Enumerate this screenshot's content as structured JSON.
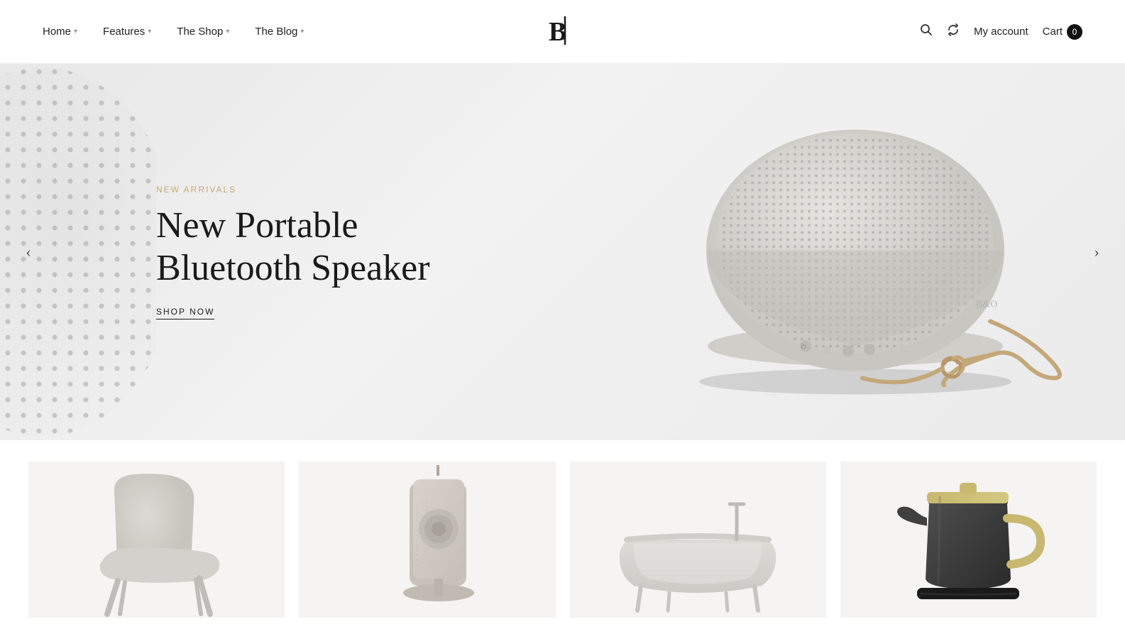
{
  "header": {
    "nav": [
      {
        "label": "Home",
        "has_dropdown": true
      },
      {
        "label": "Features",
        "has_dropdown": true
      },
      {
        "label": "The Shop",
        "has_dropdown": true
      },
      {
        "label": "The Blog",
        "has_dropdown": true
      }
    ],
    "logo_alt": "B Logo",
    "my_account_label": "My account",
    "cart_label": "Cart",
    "cart_count": "0"
  },
  "hero": {
    "tag": "NEW ARRIVALS",
    "title_line1": "New Portable",
    "title_line2": "Bluetooth Speaker",
    "shop_now_label": "SHOP NOW",
    "prev_label": "‹",
    "next_label": "›"
  },
  "products": [
    {
      "id": "chair",
      "type": "chair"
    },
    {
      "id": "headphones",
      "type": "headphones"
    },
    {
      "id": "bath",
      "type": "bath"
    },
    {
      "id": "kettle",
      "type": "kettle"
    }
  ]
}
